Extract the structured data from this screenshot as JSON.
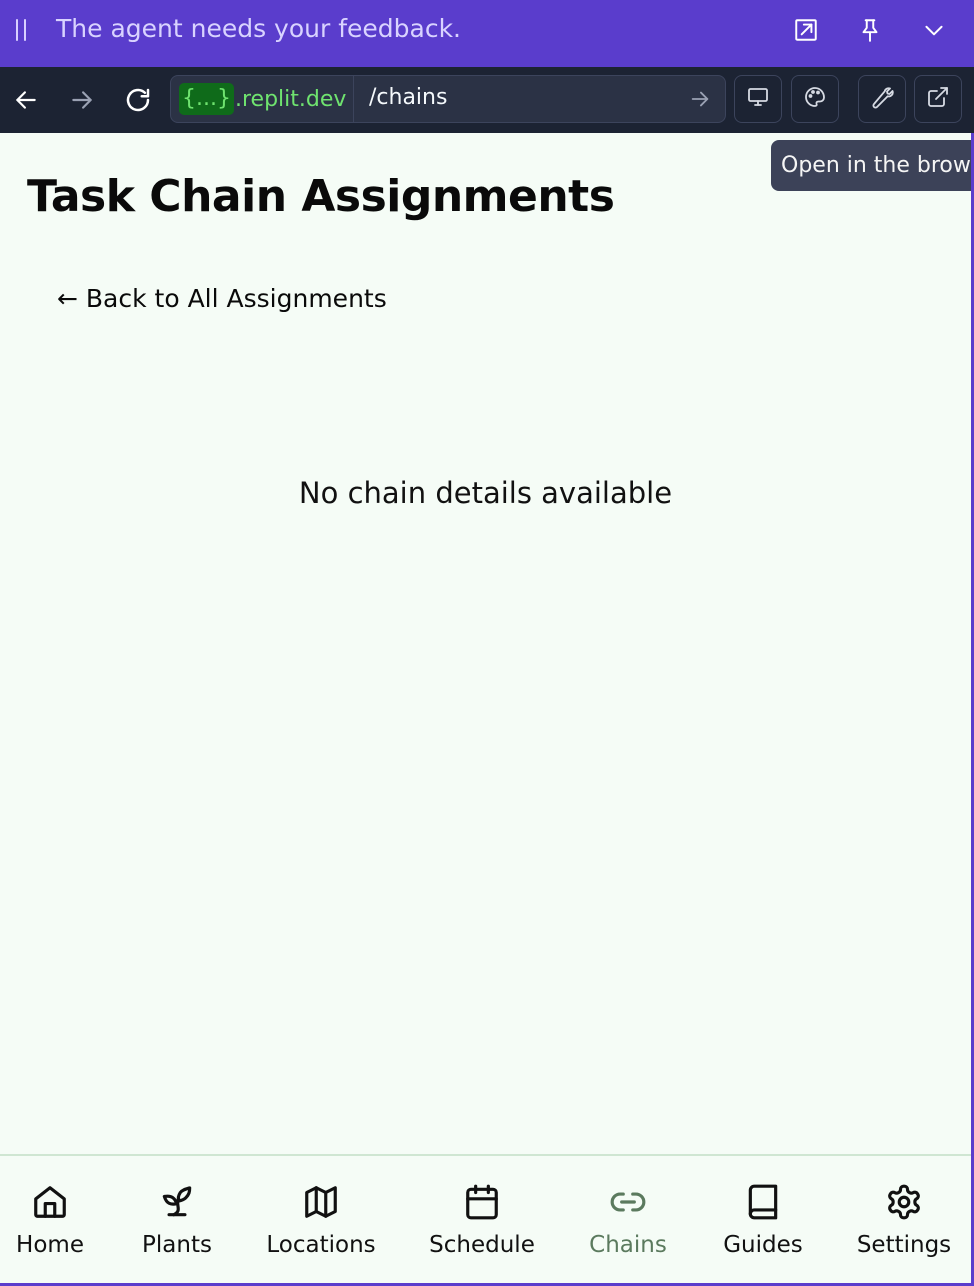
{
  "banner": {
    "message": "The agent needs your feedback."
  },
  "browser": {
    "host_tag": "{...}",
    "host_domain": ".replit.dev",
    "path": "/chains",
    "tooltip": "Open in the browser"
  },
  "page": {
    "title": "Task Chain Assignments",
    "back_link": "← Back to All Assignments",
    "empty_message": "No chain details available"
  },
  "bottom_nav": {
    "items": [
      {
        "label": "Home",
        "icon": "home-icon"
      },
      {
        "label": "Plants",
        "icon": "sprout-icon"
      },
      {
        "label": "Locations",
        "icon": "map-icon"
      },
      {
        "label": "Schedule",
        "icon": "calendar-icon"
      },
      {
        "label": "Chains",
        "icon": "link-icon",
        "active": true
      },
      {
        "label": "Guides",
        "icon": "book-icon"
      },
      {
        "label": "Settings",
        "icon": "gear-icon"
      }
    ]
  },
  "colors": {
    "banner_bg": "#5a3dcc",
    "toolbar_bg": "#1c2333",
    "page_bg": "#f5fcf6",
    "host_green": "#6fe36f",
    "active_nav": "#5b7a5e"
  }
}
